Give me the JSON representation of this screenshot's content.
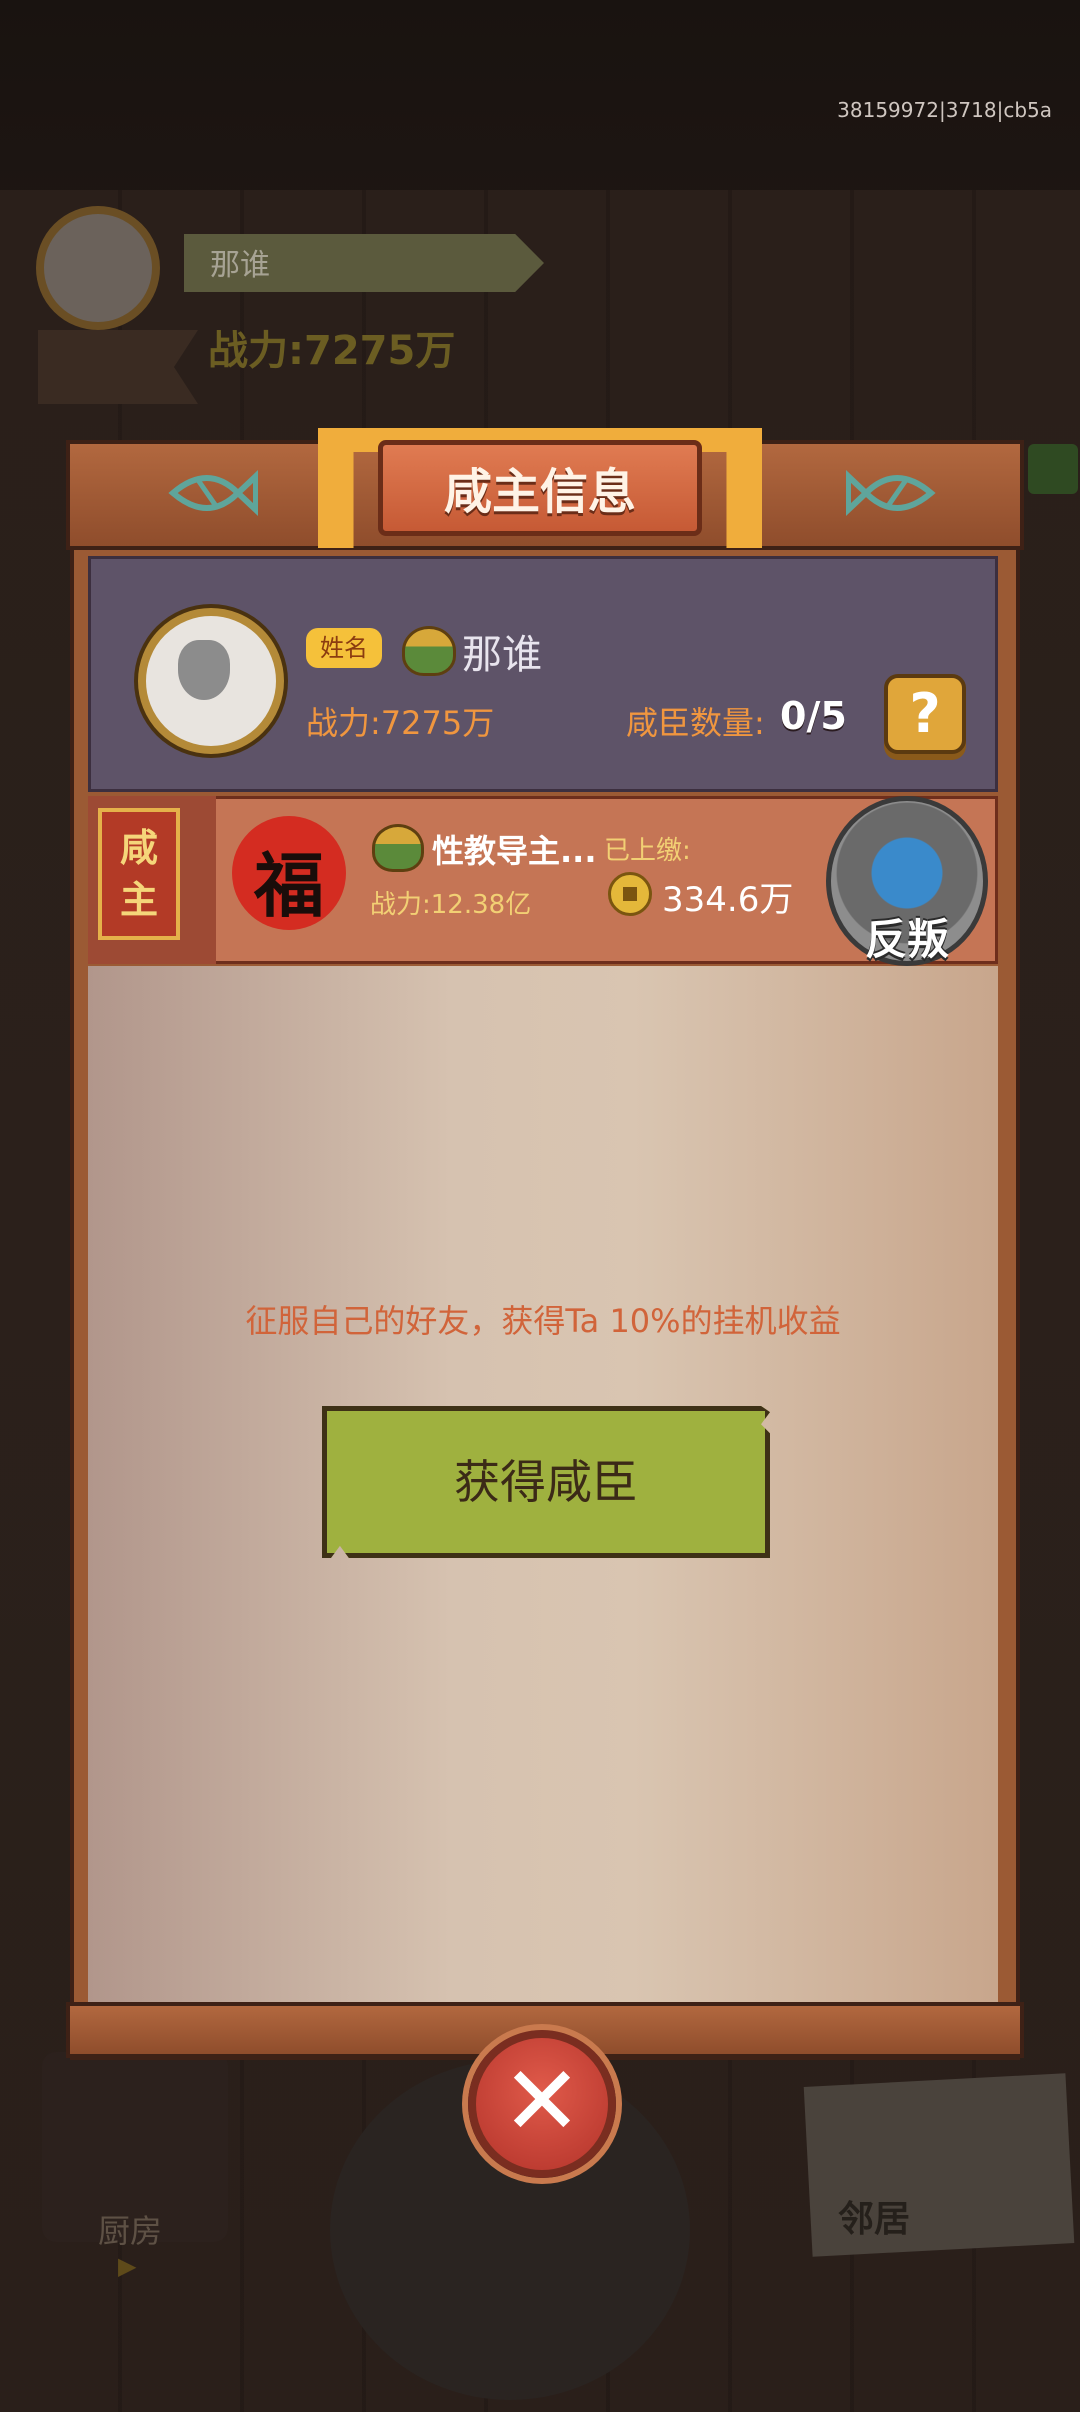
{
  "build_id": "38159972|3718|cb5a",
  "background": {
    "player_name": "那谁",
    "player_power": "战力:7275万",
    "kitchen_label": "厨房",
    "kitchen_play_icon": "play-icon",
    "neighbor_label": "邻居"
  },
  "dialog": {
    "title": "咸主信息",
    "fish_icon": "fish-icon",
    "my_info": {
      "name_tag": "姓名",
      "rank_icon": "rank-badge-icon",
      "name": "那谁",
      "power": "战力:7275万",
      "vassal_label": "咸臣数量:",
      "vassal_count": "0/5",
      "help": "?"
    },
    "lord": {
      "tag": "咸主",
      "avatar_char": "福",
      "name": "性教导主...",
      "power": "战力:12.38亿",
      "paid_label": "已上缴:",
      "coin_icon": "coin-icon",
      "paid_value": "334.6万",
      "rebel_button": "反叛"
    },
    "hint": "征服自己的好友，获得Ta 10%的挂机收益",
    "get_vassal_button": "获得咸臣",
    "close_icon": "close-icon",
    "close_symbol": "✕"
  },
  "colors": {
    "panel_wood": "#9b5a34",
    "title_plate": "#d86a43",
    "accent_orange": "#f0963f",
    "button_green": "#9fb13f",
    "close_red": "#c7423a"
  }
}
